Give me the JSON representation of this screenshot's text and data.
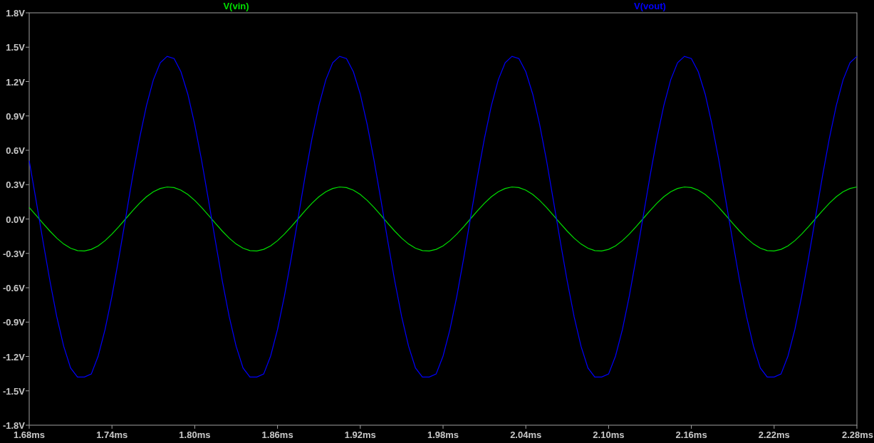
{
  "plot": {
    "chart_data": {
      "type": "line",
      "x": [
        1.68,
        1.685,
        1.69,
        1.695,
        1.7,
        1.705,
        1.71,
        1.715,
        1.72,
        1.725,
        1.73,
        1.735,
        1.74,
        1.745,
        1.75,
        1.755,
        1.76,
        1.765,
        1.77,
        1.775,
        1.78,
        1.785,
        1.79,
        1.795,
        1.8,
        1.805,
        1.81,
        1.815,
        1.82,
        1.825,
        1.83,
        1.835,
        1.84,
        1.845,
        1.85,
        1.855,
        1.86,
        1.865,
        1.87,
        1.875,
        1.88,
        1.885,
        1.89,
        1.895,
        1.9,
        1.905,
        1.91,
        1.915,
        1.92,
        1.925,
        1.93,
        1.935,
        1.94,
        1.945,
        1.95,
        1.955,
        1.96,
        1.965,
        1.97,
        1.975,
        1.98,
        1.985,
        1.99,
        1.995,
        2.0,
        2.005,
        2.01,
        2.015,
        2.02,
        2.025,
        2.03,
        2.035,
        2.04,
        2.045,
        2.05,
        2.055,
        2.06,
        2.065,
        2.07,
        2.075,
        2.08,
        2.085,
        2.09,
        2.095,
        2.1,
        2.105,
        2.11,
        2.115,
        2.12,
        2.125,
        2.13,
        2.135,
        2.14,
        2.145,
        2.15,
        2.155,
        2.16,
        2.165,
        2.17,
        2.175,
        2.18,
        2.185,
        2.19,
        2.195,
        2.2,
        2.205,
        2.21,
        2.215,
        2.22,
        2.225,
        2.23,
        2.235,
        2.24,
        2.245,
        2.25,
        2.255,
        2.26,
        2.265,
        2.27,
        2.275,
        2.28
      ],
      "series": [
        {
          "name": "V(vin)",
          "color": "#00e000",
          "values": [
            0.1,
            0.032,
            -0.038,
            -0.106,
            -0.167,
            -0.218,
            -0.255,
            -0.276,
            -0.279,
            -0.265,
            -0.235,
            -0.189,
            -0.132,
            -0.066,
            0.003,
            0.073,
            0.138,
            0.194,
            0.238,
            0.267,
            0.28,
            0.274,
            0.252,
            0.214,
            0.162,
            0.1,
            0.032,
            -0.038,
            -0.106,
            -0.167,
            -0.218,
            -0.255,
            -0.276,
            -0.279,
            -0.265,
            -0.235,
            -0.189,
            -0.132,
            -0.066,
            0.003,
            0.073,
            0.138,
            0.194,
            0.238,
            0.267,
            0.28,
            0.274,
            0.252,
            0.214,
            0.162,
            0.1,
            0.032,
            -0.038,
            -0.106,
            -0.167,
            -0.218,
            -0.255,
            -0.276,
            -0.279,
            -0.265,
            -0.235,
            -0.189,
            -0.132,
            -0.066,
            0.003,
            0.073,
            0.138,
            0.194,
            0.238,
            0.267,
            0.28,
            0.274,
            0.252,
            0.214,
            0.162,
            0.1,
            0.032,
            -0.038,
            -0.106,
            -0.167,
            -0.218,
            -0.255,
            -0.276,
            -0.279,
            -0.265,
            -0.235,
            -0.189,
            -0.132,
            -0.066,
            0.003,
            0.073,
            0.138,
            0.194,
            0.238,
            0.267,
            0.28,
            0.274,
            0.252,
            0.214,
            0.162,
            0.1,
            0.032,
            -0.038,
            -0.106,
            -0.167,
            -0.218,
            -0.255,
            -0.276,
            -0.279,
            -0.265,
            -0.235,
            -0.189,
            -0.132,
            -0.066,
            0.003,
            0.073,
            0.138,
            0.194,
            0.238,
            0.267,
            0.28
          ]
        },
        {
          "name": "V(vout)",
          "color": "#0000ff",
          "values": [
            0.51,
            0.161,
            -0.196,
            -0.541,
            -0.853,
            -1.111,
            -1.3,
            -1.38,
            -1.38,
            -1.353,
            -1.197,
            -0.965,
            -0.673,
            -0.338,
            0.017,
            0.372,
            0.703,
            0.99,
            1.215,
            1.364,
            1.42,
            1.4,
            1.285,
            1.09,
            0.825,
            0.51,
            0.161,
            -0.196,
            -0.541,
            -0.853,
            -1.111,
            -1.3,
            -1.38,
            -1.38,
            -1.353,
            -1.197,
            -0.965,
            -0.673,
            -0.338,
            0.017,
            0.372,
            0.703,
            0.99,
            1.215,
            1.364,
            1.42,
            1.4,
            1.285,
            1.09,
            0.825,
            0.51,
            0.161,
            -0.196,
            -0.541,
            -0.853,
            -1.111,
            -1.3,
            -1.38,
            -1.38,
            -1.353,
            -1.197,
            -0.965,
            -0.673,
            -0.338,
            0.017,
            0.372,
            0.703,
            0.99,
            1.215,
            1.364,
            1.42,
            1.4,
            1.285,
            1.09,
            0.825,
            0.51,
            0.161,
            -0.196,
            -0.541,
            -0.853,
            -1.111,
            -1.3,
            -1.38,
            -1.38,
            -1.353,
            -1.197,
            -0.965,
            -0.673,
            -0.338,
            0.017,
            0.372,
            0.703,
            0.99,
            1.215,
            1.364,
            1.42,
            1.4,
            1.285,
            1.09,
            0.825,
            0.51,
            0.161,
            -0.196,
            -0.541,
            -0.853,
            -1.111,
            -1.3,
            -1.38,
            -1.38,
            -1.353,
            -1.197,
            -0.965,
            -0.673,
            -0.338,
            0.017,
            0.372,
            0.703,
            0.99,
            1.215,
            1.364,
            1.42
          ]
        }
      ],
      "xlim": [
        1.68,
        2.28
      ],
      "ylim": [
        -1.8,
        1.8
      ],
      "xticks": [
        {
          "value": 1.68,
          "label": "1.68ms"
        },
        {
          "value": 1.74,
          "label": "1.74ms"
        },
        {
          "value": 1.8,
          "label": "1.80ms"
        },
        {
          "value": 1.86,
          "label": "1.86ms"
        },
        {
          "value": 1.92,
          "label": "1.92ms"
        },
        {
          "value": 1.98,
          "label": "1.98ms"
        },
        {
          "value": 2.04,
          "label": "2.04ms"
        },
        {
          "value": 2.1,
          "label": "2.10ms"
        },
        {
          "value": 2.16,
          "label": "2.16ms"
        },
        {
          "value": 2.22,
          "label": "2.22ms"
        },
        {
          "value": 2.28,
          "label": "2.28ms"
        }
      ],
      "yticks": [
        {
          "value": 1.8,
          "label": "1.8V"
        },
        {
          "value": 1.5,
          "label": "1.5V"
        },
        {
          "value": 1.2,
          "label": "1.2V"
        },
        {
          "value": 0.9,
          "label": "0.9V"
        },
        {
          "value": 0.6,
          "label": "0.6V"
        },
        {
          "value": 0.3,
          "label": "0.3V"
        },
        {
          "value": 0,
          "label": "0.0V"
        },
        {
          "value": -0.3,
          "label": "-0.3V"
        },
        {
          "value": -0.6,
          "label": "-0.6V"
        },
        {
          "value": -0.9,
          "label": "-0.9V"
        },
        {
          "value": -1.2,
          "label": "-1.2V"
        },
        {
          "value": -1.5,
          "label": "-1.5V"
        },
        {
          "value": -1.8,
          "label": "-1.8V"
        }
      ]
    }
  }
}
